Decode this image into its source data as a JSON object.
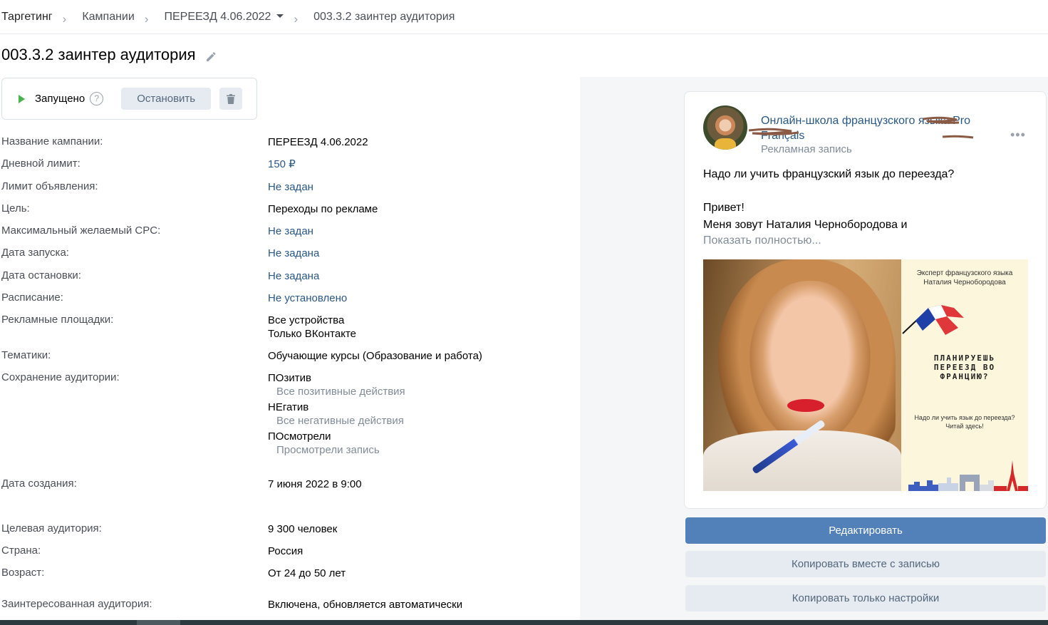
{
  "breadcrumb": {
    "items": [
      "Таргетинг",
      "Кампании",
      "ПЕРЕЕЗД 4.06.2022",
      "003.3.2 заинтер аудитория"
    ],
    "separator": "›"
  },
  "page": {
    "title": "003.3.2 заинтер аудитория"
  },
  "status": {
    "text": "Запущено",
    "help": "?",
    "stop_label": "Остановить"
  },
  "details": {
    "campaign_name": {
      "label": "Название кампании:",
      "value": "ПЕРЕЕЗД 4.06.2022"
    },
    "daily_limit": {
      "label": "Дневной лимит:",
      "value": "150 ₽"
    },
    "ad_limit": {
      "label": "Лимит объявления:",
      "value": "Не задан"
    },
    "goal": {
      "label": "Цель:",
      "value": "Переходы по рекламе"
    },
    "max_cpc": {
      "label": "Максимальный желаемый CPC:",
      "value": "Не задан"
    },
    "start_date": {
      "label": "Дата запуска:",
      "value": "Не задана"
    },
    "stop_date": {
      "label": "Дата остановки:",
      "value": "Не задана"
    },
    "schedule": {
      "label": "Расписание:",
      "value": "Не установлено"
    },
    "platforms": {
      "label": "Рекламные площадки:",
      "values": [
        "Все устройства",
        "Только ВКонтакте"
      ]
    },
    "topics": {
      "label": "Тематики:",
      "value": "Обучающие курсы (Образование и работа)"
    },
    "audience_save": {
      "label": "Сохранение аудитории:",
      "items": [
        {
          "name": "ПОзитив",
          "desc": "Все позитивные действия"
        },
        {
          "name": "НЕгатив",
          "desc": "Все негативные действия"
        },
        {
          "name": "ПОсмотрели",
          "desc": "Просмотрели запись"
        }
      ]
    },
    "created": {
      "label": "Дата создания:",
      "value": "7 июня 2022 в 9:00"
    },
    "target_audience": {
      "label": "Целевая аудитория:",
      "value": "9 300 человек"
    },
    "country": {
      "label": "Страна:",
      "value": "Россия"
    },
    "age": {
      "label": "Возраст:",
      "value": "От 24 до 50 лет"
    },
    "interested": {
      "label": "Заинтересованная аудитория:",
      "value": "Включена, обновляется автоматически"
    }
  },
  "post": {
    "group_name": "Онлайн-школа французского языка Pro Français",
    "ad_label": "Рекламная запись",
    "more": "•••",
    "text_line1": "Надо ли учить французский язык до переезда?",
    "text_line2": "Привет!",
    "text_line3": "Меня зовут Наталия Чернобородова и",
    "show_more": "Показать полностью...",
    "image": {
      "top_line1": "Эксперт французского языка",
      "top_line2": "Наталия Чернобородова",
      "title_line1": "ПЛАНИРУЕШЬ",
      "title_line2": "ПЕРЕЕЗД ВО",
      "title_line3": "ФРАНЦИЮ?",
      "bottom_line1": "Надо ли учить язык до переезда?",
      "bottom_line2": "Читай здесь!"
    }
  },
  "actions": {
    "edit": "Редактировать",
    "copy_with_post": "Копировать вместе с записью",
    "copy_settings": "Копировать только настройки"
  },
  "colors": {
    "link": "#2a5885",
    "primary_button": "#5181b8",
    "secondary_button": "#e5ebf1",
    "status_green": "#4bb34b"
  }
}
